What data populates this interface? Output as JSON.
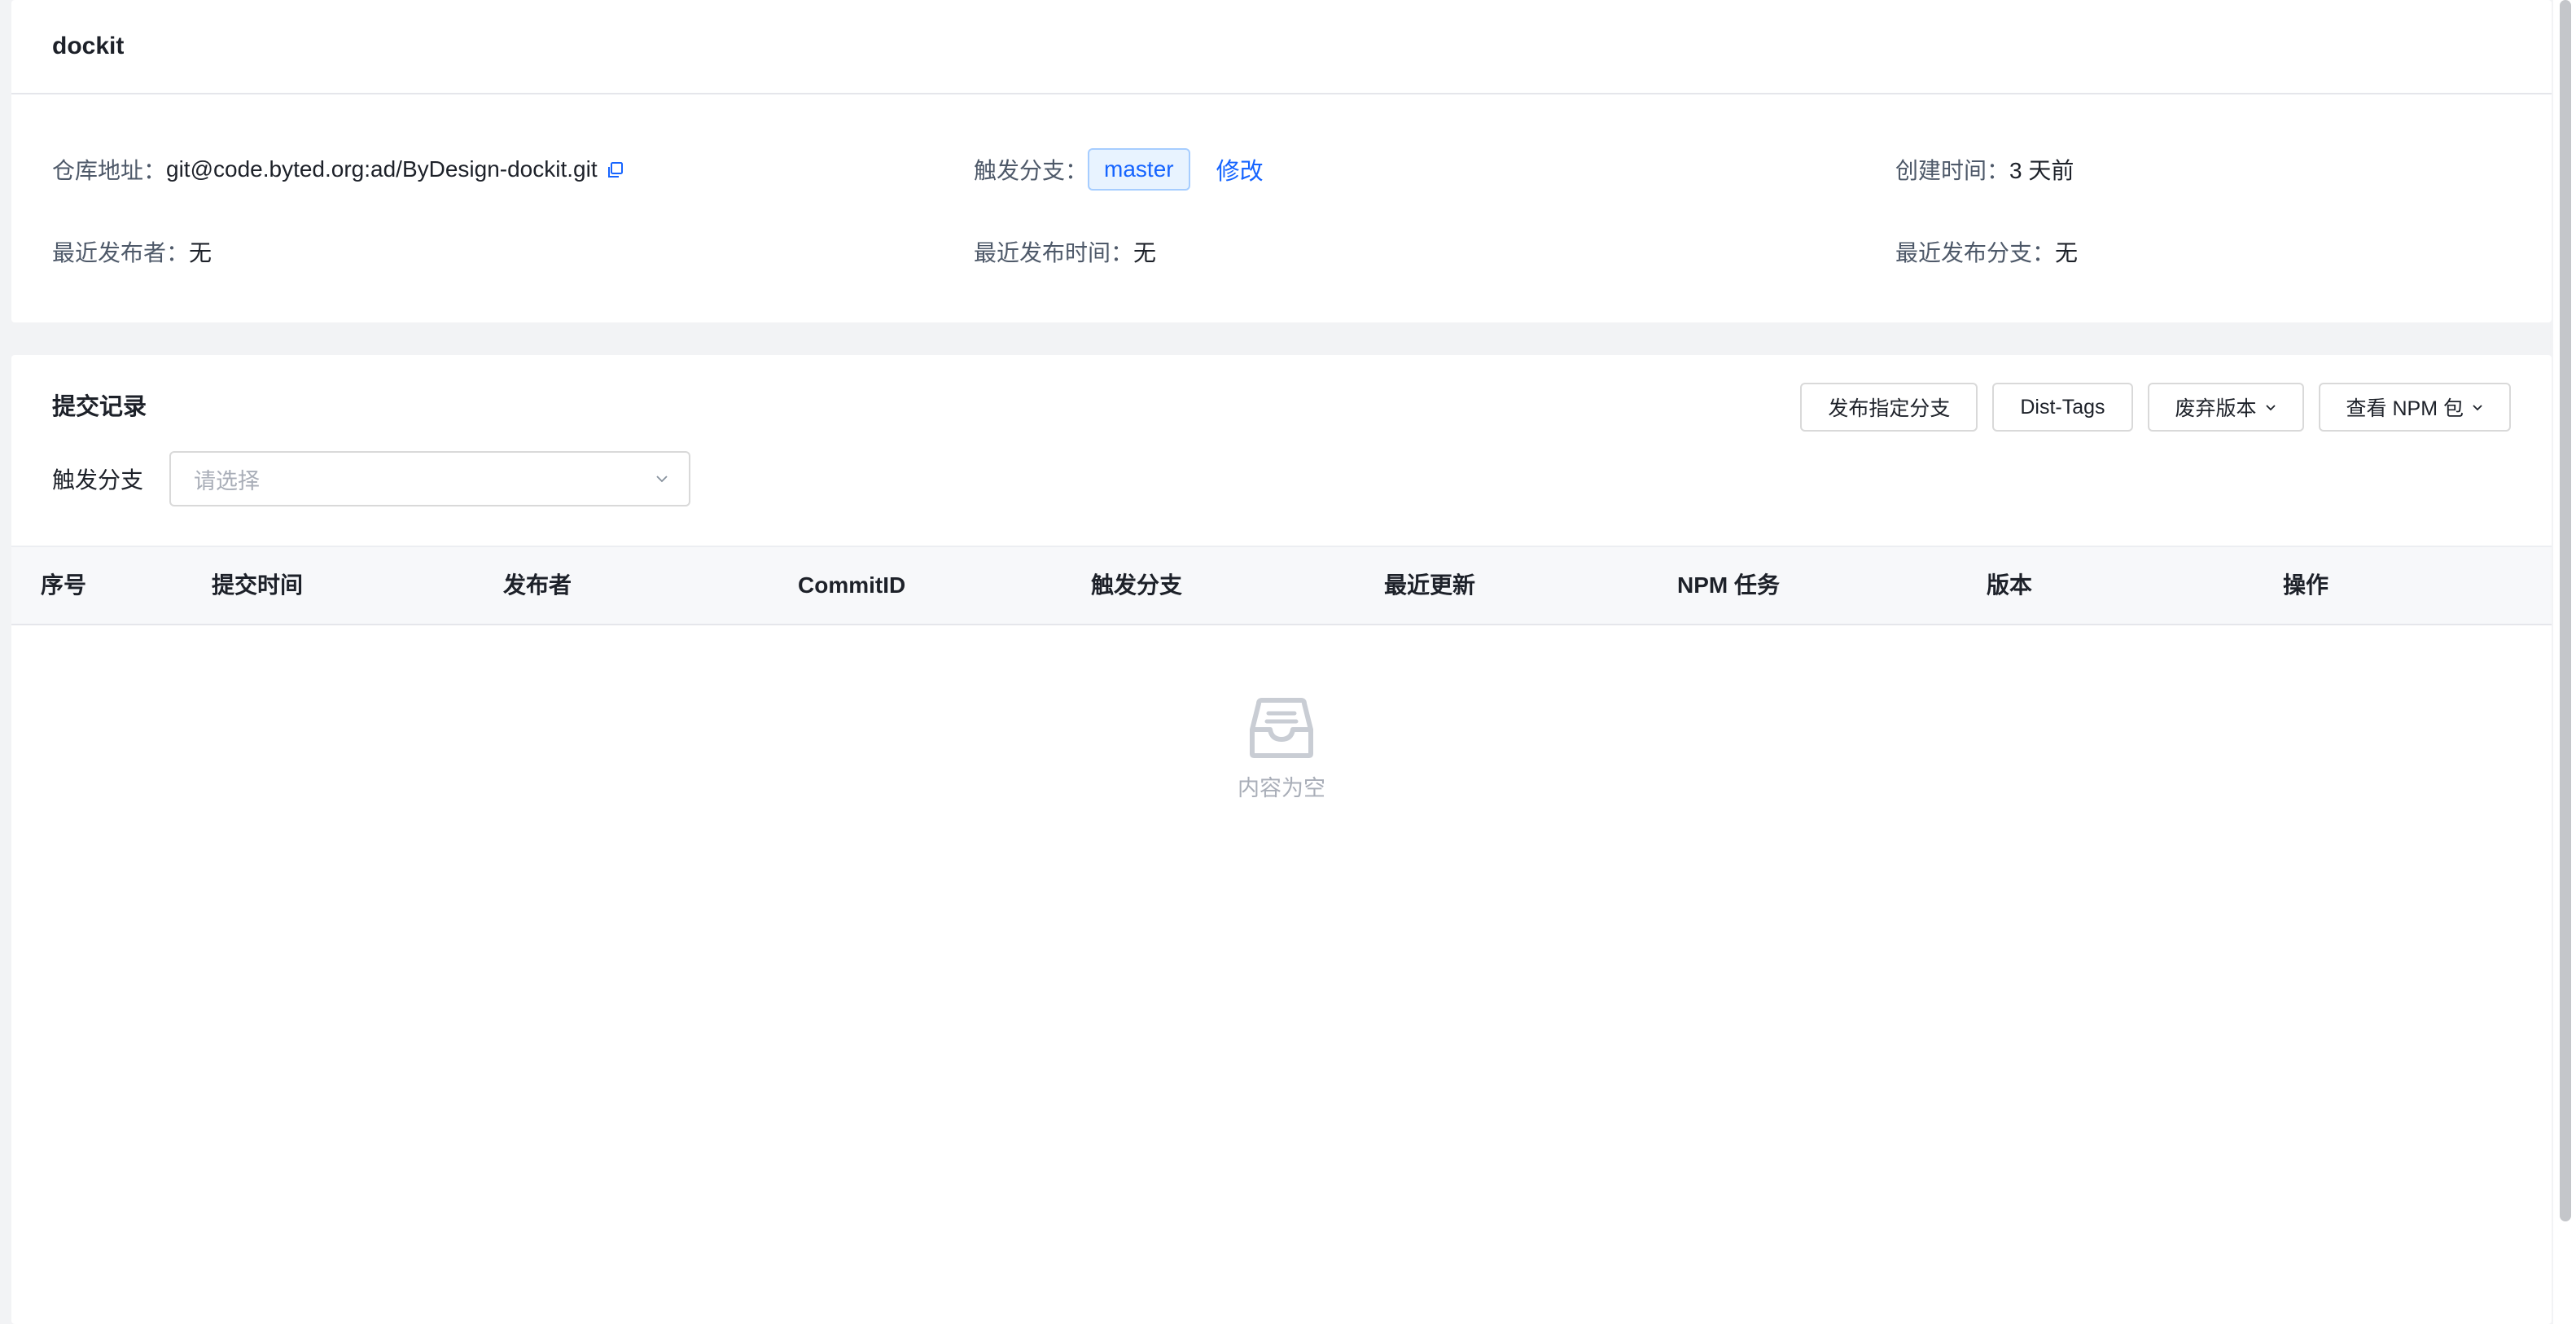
{
  "repo_card": {
    "title": "dockit",
    "repo_url_label": "仓库地址：",
    "repo_url": "git@code.byted.org:ad/ByDesign-dockit.git",
    "trigger_branch_label": "触发分支：",
    "trigger_branch": "master",
    "edit_label": "修改",
    "created_label": "创建时间：",
    "created_value": "3 天前",
    "last_publisher_label": "最近发布者：",
    "last_publisher": "无",
    "last_publish_time_label": "最近发布时间：",
    "last_publish_time": "无",
    "last_publish_branch_label": "最近发布分支：",
    "last_publish_branch": "无"
  },
  "commits": {
    "title": "提交记录",
    "buttons": {
      "publish_branch": "发布指定分支",
      "dist_tags": "Dist-Tags",
      "deprecate": "废弃版本",
      "view_npm": "查看 NPM 包"
    },
    "filter": {
      "label": "触发分支",
      "placeholder": "请选择"
    },
    "columns": [
      "序号",
      "提交时间",
      "发布者",
      "CommitID",
      "触发分支",
      "最近更新",
      "NPM 任务",
      "版本",
      "操作"
    ],
    "empty_text": "内容为空"
  },
  "colors": {
    "primary": "#1664ff",
    "tag_bg": "#e8f3ff",
    "text": "#1d2129",
    "muted": "#a9aeb8"
  }
}
